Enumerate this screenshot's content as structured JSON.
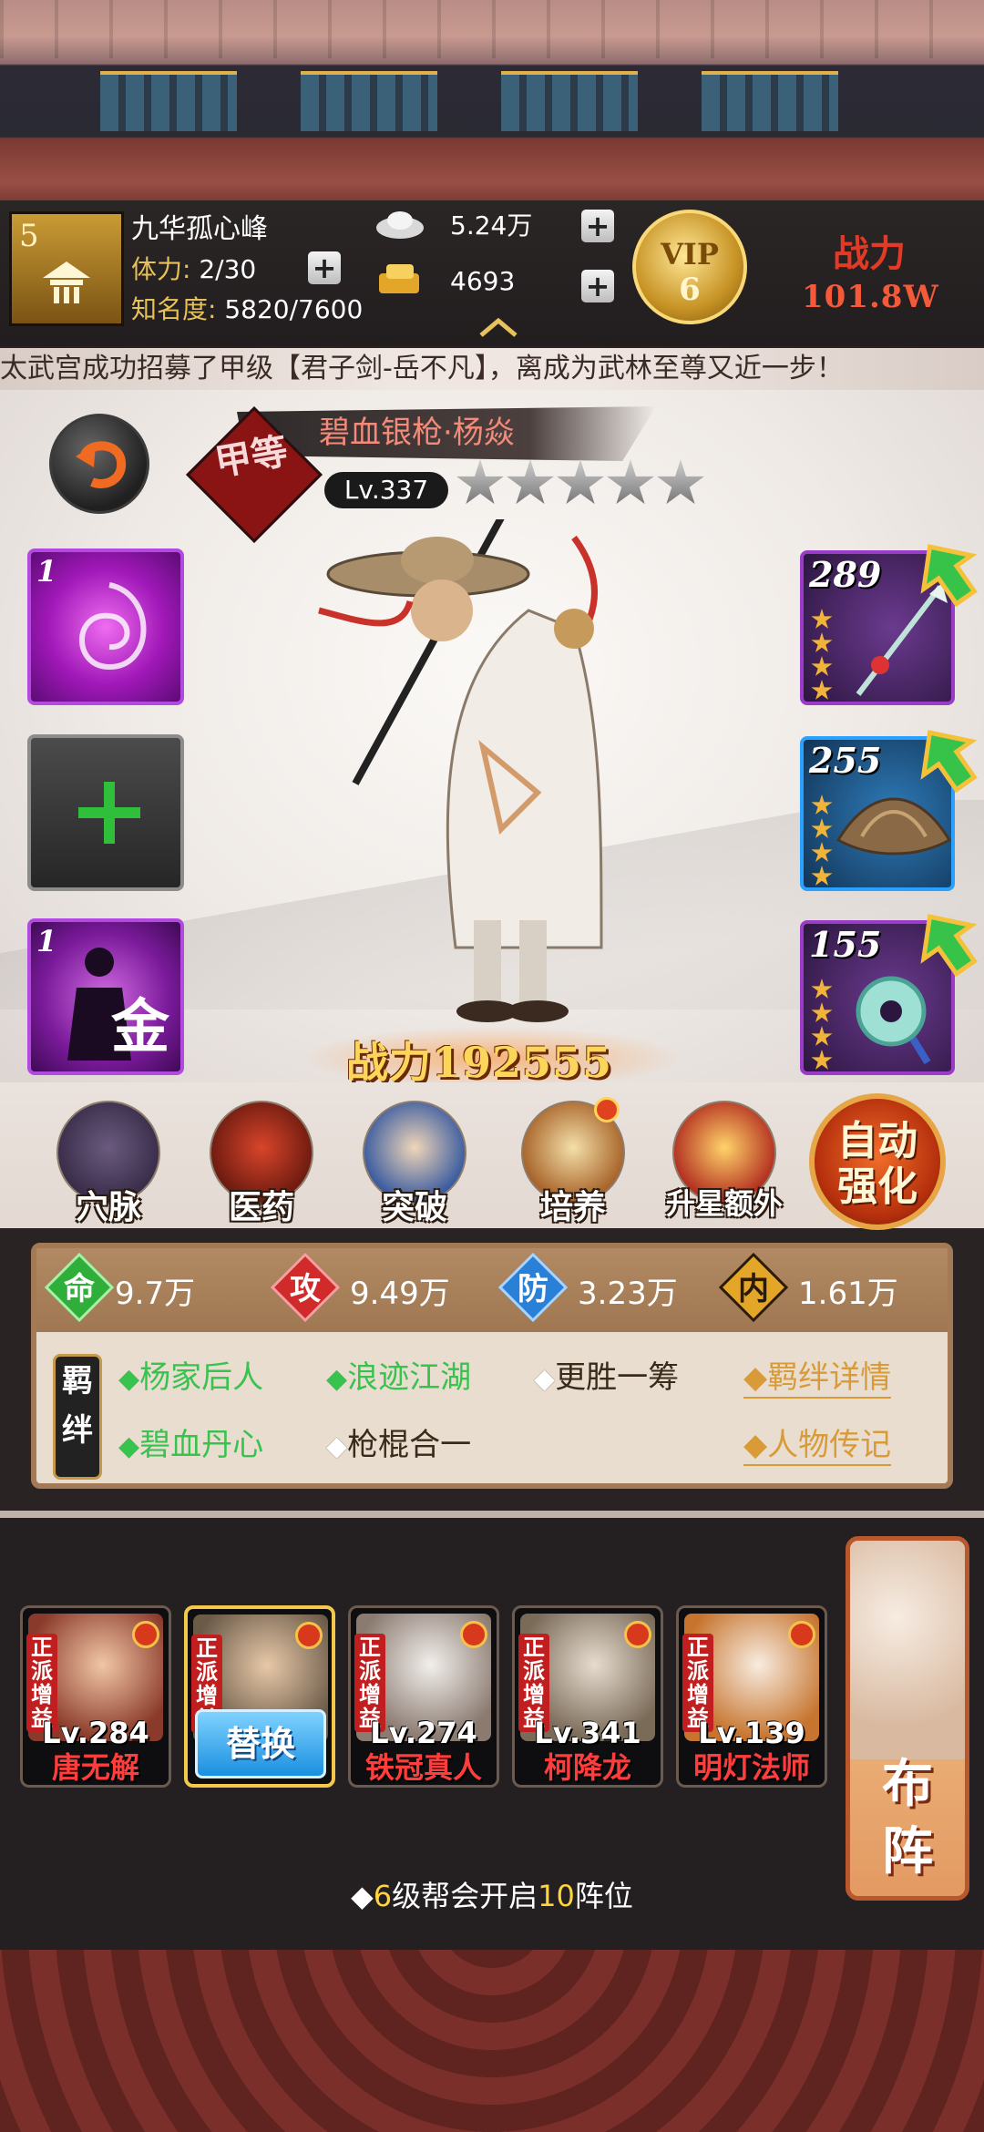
{
  "player": {
    "level": "5",
    "name": "九华孤心峰",
    "stamina_label": "体力:",
    "stamina_value": "2/30",
    "fame_label": "知名度:",
    "fame_value": "5820/7600"
  },
  "currency": {
    "silver": "5.24万",
    "gold": "4693"
  },
  "vip": {
    "label": "VIP",
    "level": "6"
  },
  "top_power": {
    "label": "战力",
    "value": "101.8W"
  },
  "ticker": "太武宫成功招募了甲级【君子剑-岳不凡】，离成为武林至尊又近一步！",
  "hero": {
    "grade": "甲等",
    "name": "碧血银枪·杨焱",
    "level": "Lv.337",
    "stars_filled": 0,
    "stars_total": 5,
    "combat_power": "战力192555"
  },
  "skills": [
    {
      "count": "1",
      "icon": "purple-swirl-icon"
    },
    {
      "count": "",
      "icon": "add-cross-icon"
    },
    {
      "count": "1",
      "icon": "gold-silhouette-icon",
      "badge": "金"
    }
  ],
  "equipment": [
    {
      "level": "289",
      "stars": 4,
      "icon": "spear-icon"
    },
    {
      "level": "255",
      "stars": 4,
      "icon": "straw-hat-icon"
    },
    {
      "level": "155",
      "stars": 4,
      "icon": "jade-pendant-icon"
    }
  ],
  "actions": [
    {
      "label": "穴脉",
      "icon": "meridian-icon",
      "dot": false
    },
    {
      "label": "医药",
      "icon": "medicine-icon",
      "dot": false
    },
    {
      "label": "突破",
      "icon": "breakthrough-icon",
      "dot": false
    },
    {
      "label": "培养",
      "icon": "scroll-icon",
      "dot": true
    },
    {
      "label": "升星额外",
      "icon": "star-up-icon",
      "dot": false
    }
  ],
  "auto_enhance": {
    "line1": "自动",
    "line2": "强化"
  },
  "attributes": [
    {
      "glyph": "命",
      "value": "9.7万",
      "color": "#2fae3a"
    },
    {
      "glyph": "攻",
      "value": "9.49万",
      "color": "#d12a2a"
    },
    {
      "glyph": "防",
      "value": "3.23万",
      "color": "#2a7fd6"
    },
    {
      "glyph": "内",
      "value": "1.61万",
      "color": "#e3a628"
    }
  ],
  "bond_badge": "羁绊",
  "bonds": [
    {
      "text": "杨家后人",
      "active": true
    },
    {
      "text": "浪迹江湖",
      "active": true
    },
    {
      "text": "更胜一筹",
      "active": false
    },
    {
      "text": "碧血丹心",
      "active": true
    },
    {
      "text": "枪棍合一",
      "active": false
    }
  ],
  "links": {
    "bond_detail": "◆羁绊详情",
    "biography": "◆人物传记"
  },
  "team": [
    {
      "tag": "正派增益",
      "level": "Lv.284",
      "name": "唐无解",
      "selected": false
    },
    {
      "tag": "正派增益",
      "level": "",
      "name": "",
      "selected": true,
      "button": "替换"
    },
    {
      "tag": "正派增益",
      "level": "Lv.274",
      "name": "铁冠真人",
      "selected": false
    },
    {
      "tag": "正派增益",
      "level": "Lv.341",
      "name": "柯降龙",
      "selected": false
    },
    {
      "tag": "正派增益",
      "level": "Lv.139",
      "name": "明灯法师",
      "selected": false
    }
  ],
  "formation": {
    "line1": "布",
    "line2": "阵"
  },
  "notice": {
    "prefix": "◆",
    "num1": "6",
    "mid": "级帮会开启",
    "num2": "10",
    "suffix": "阵位"
  }
}
